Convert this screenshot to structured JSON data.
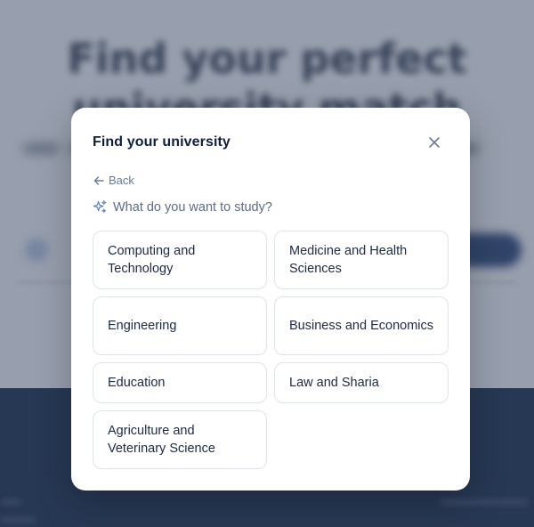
{
  "background": {
    "hero_lines": [
      "Find your perfect",
      "university match"
    ]
  },
  "modal": {
    "title": "Find your university",
    "back_label": "Back",
    "question": "What do you want to study?",
    "options": [
      "Computing and Technology",
      "Medicine and Health Sciences",
      "Engineering",
      "Business and Economics",
      "Education",
      "Law and Sharia",
      "Agriculture and Veterinary Science"
    ]
  },
  "colors": {
    "title": "#0f1f3d",
    "muted": "#6b7a93",
    "border": "#dfe3ea",
    "footer_bg": "#0e2344"
  },
  "icons": {
    "close": "close-icon",
    "back": "arrow-left-icon",
    "question": "sparkles-icon"
  }
}
